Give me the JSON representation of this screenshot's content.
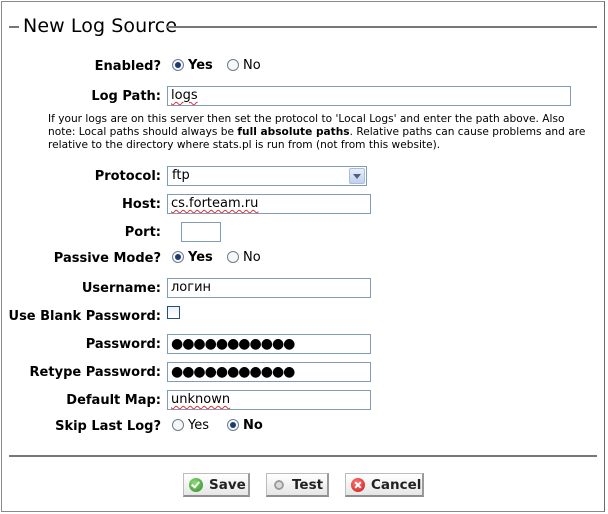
{
  "title": "New Log Source",
  "enabled": {
    "label": "Enabled?",
    "options": [
      "Yes",
      "No"
    ],
    "selected": "Yes"
  },
  "log_path": {
    "label": "Log Path:",
    "value": "logs"
  },
  "help": {
    "part1": "If your logs are on this server then set the protocol to 'Local Logs' and enter the path above. Also note: Local paths should always be ",
    "bold": "full absolute paths",
    "part2": ". Relative paths can cause problems and are relative to the directory where stats.pl is run from (not from this website)."
  },
  "protocol": {
    "label": "Protocol:",
    "value": "ftp"
  },
  "host": {
    "label": "Host:",
    "value": "cs.forteam.ru"
  },
  "port": {
    "label": "Port:",
    "value": ""
  },
  "passive_mode": {
    "label": "Passive Mode?",
    "options": [
      "Yes",
      "No"
    ],
    "selected": "Yes"
  },
  "username": {
    "label": "Username:",
    "value": "логин"
  },
  "blank_password": {
    "label": "Use Blank Password:",
    "checked": false
  },
  "password": {
    "label": "Password:",
    "value": "●●●●●●●●●●●"
  },
  "retype_password": {
    "label": "Retype Password:",
    "value": "●●●●●●●●●●●"
  },
  "default_map": {
    "label": "Default Map:",
    "value": "unknown"
  },
  "skip_last_log": {
    "label": "Skip Last Log?",
    "options": [
      "Yes",
      "No"
    ],
    "selected": "No"
  },
  "buttons": {
    "save": "Save",
    "test": "Test",
    "cancel": "Cancel"
  },
  "icons": {
    "save": "check-circle-icon",
    "test": "gear-icon",
    "cancel": "x-circle-icon"
  }
}
